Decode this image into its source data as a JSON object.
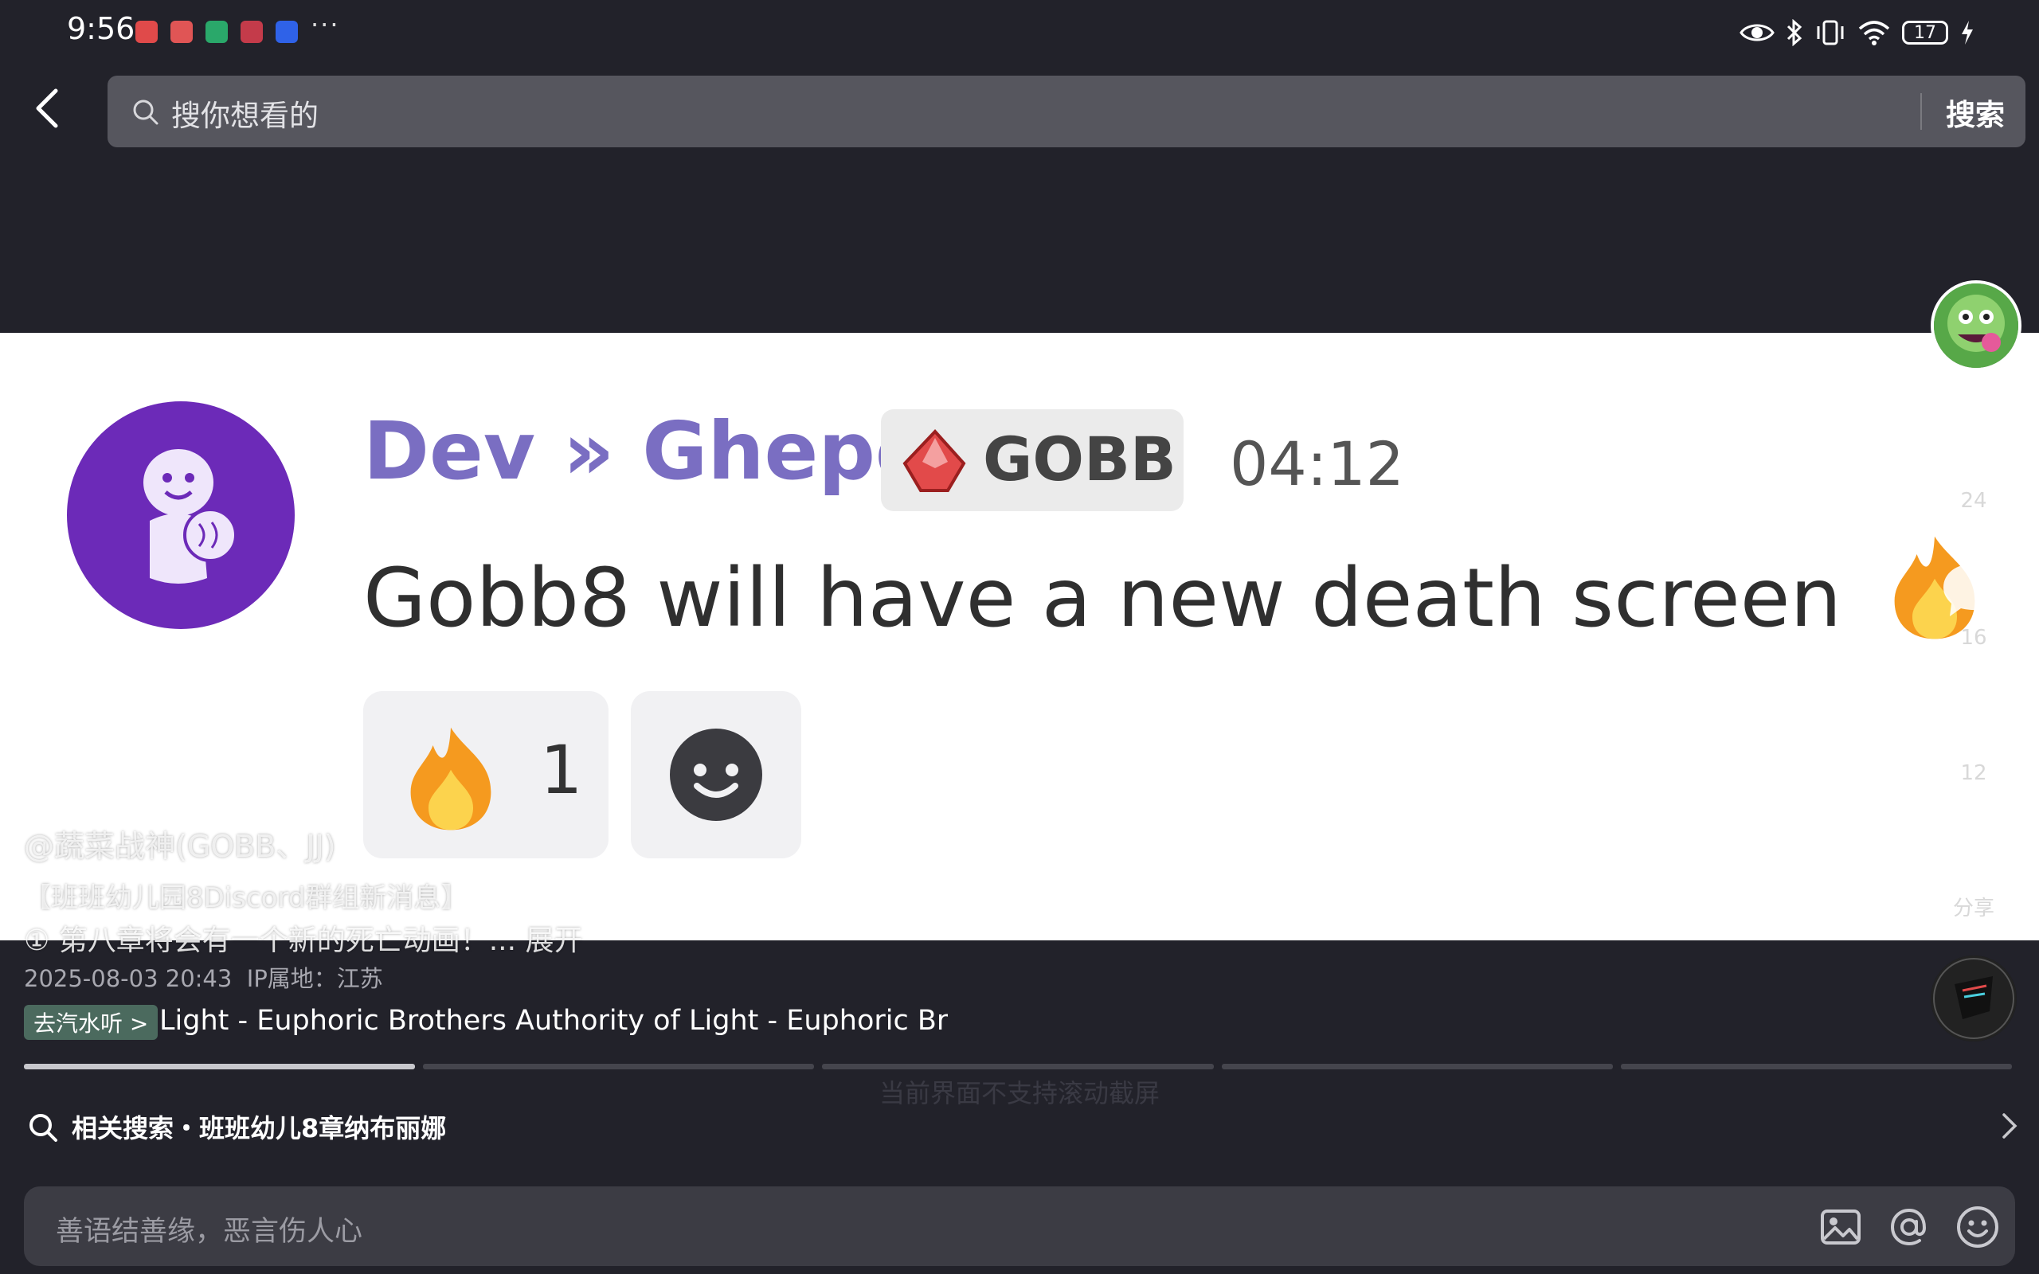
{
  "status_bar": {
    "time": "9:56",
    "more": "···",
    "battery": "17",
    "icons": [
      "eye-icon",
      "bluetooth-icon",
      "vibrate-icon",
      "wifi-icon",
      "battery-icon",
      "charging-icon"
    ]
  },
  "search": {
    "placeholder": "搜你想看的",
    "submit_label": "搜索"
  },
  "message": {
    "author": "Dev » Ghepo",
    "tag": "GOBB",
    "time": "04:12",
    "text": "Gobb8 will have a new death screen",
    "reaction_count": "1"
  },
  "side_actions": {
    "likes": "24",
    "comments": "16",
    "favorites": "12",
    "share_label": "分享"
  },
  "post": {
    "author": "@蔬菜战神(GOBB、JJ)",
    "line1": "【班班幼儿园8Discord群组新消息】",
    "line2": "① 第八章将会有一个新的死亡动画！... 展开",
    "date": "2025-08-03 20:43",
    "ip_location": "IP属地：江苏"
  },
  "music": {
    "tag": "去汽水听 >",
    "title": "Light - Euphoric Brothers    Authority of Light - Euphoric Broth"
  },
  "toast": "当前界面不支持滚动截屏",
  "related": {
    "text": "相关搜索・班班幼儿8章纳布丽娜"
  },
  "comment": {
    "placeholder": "善语结善缘，恶言伤人心"
  },
  "colors": {
    "background": "#22222a",
    "accent_purple": "#7a6ec2",
    "music_tag": "#4b6a5e"
  }
}
